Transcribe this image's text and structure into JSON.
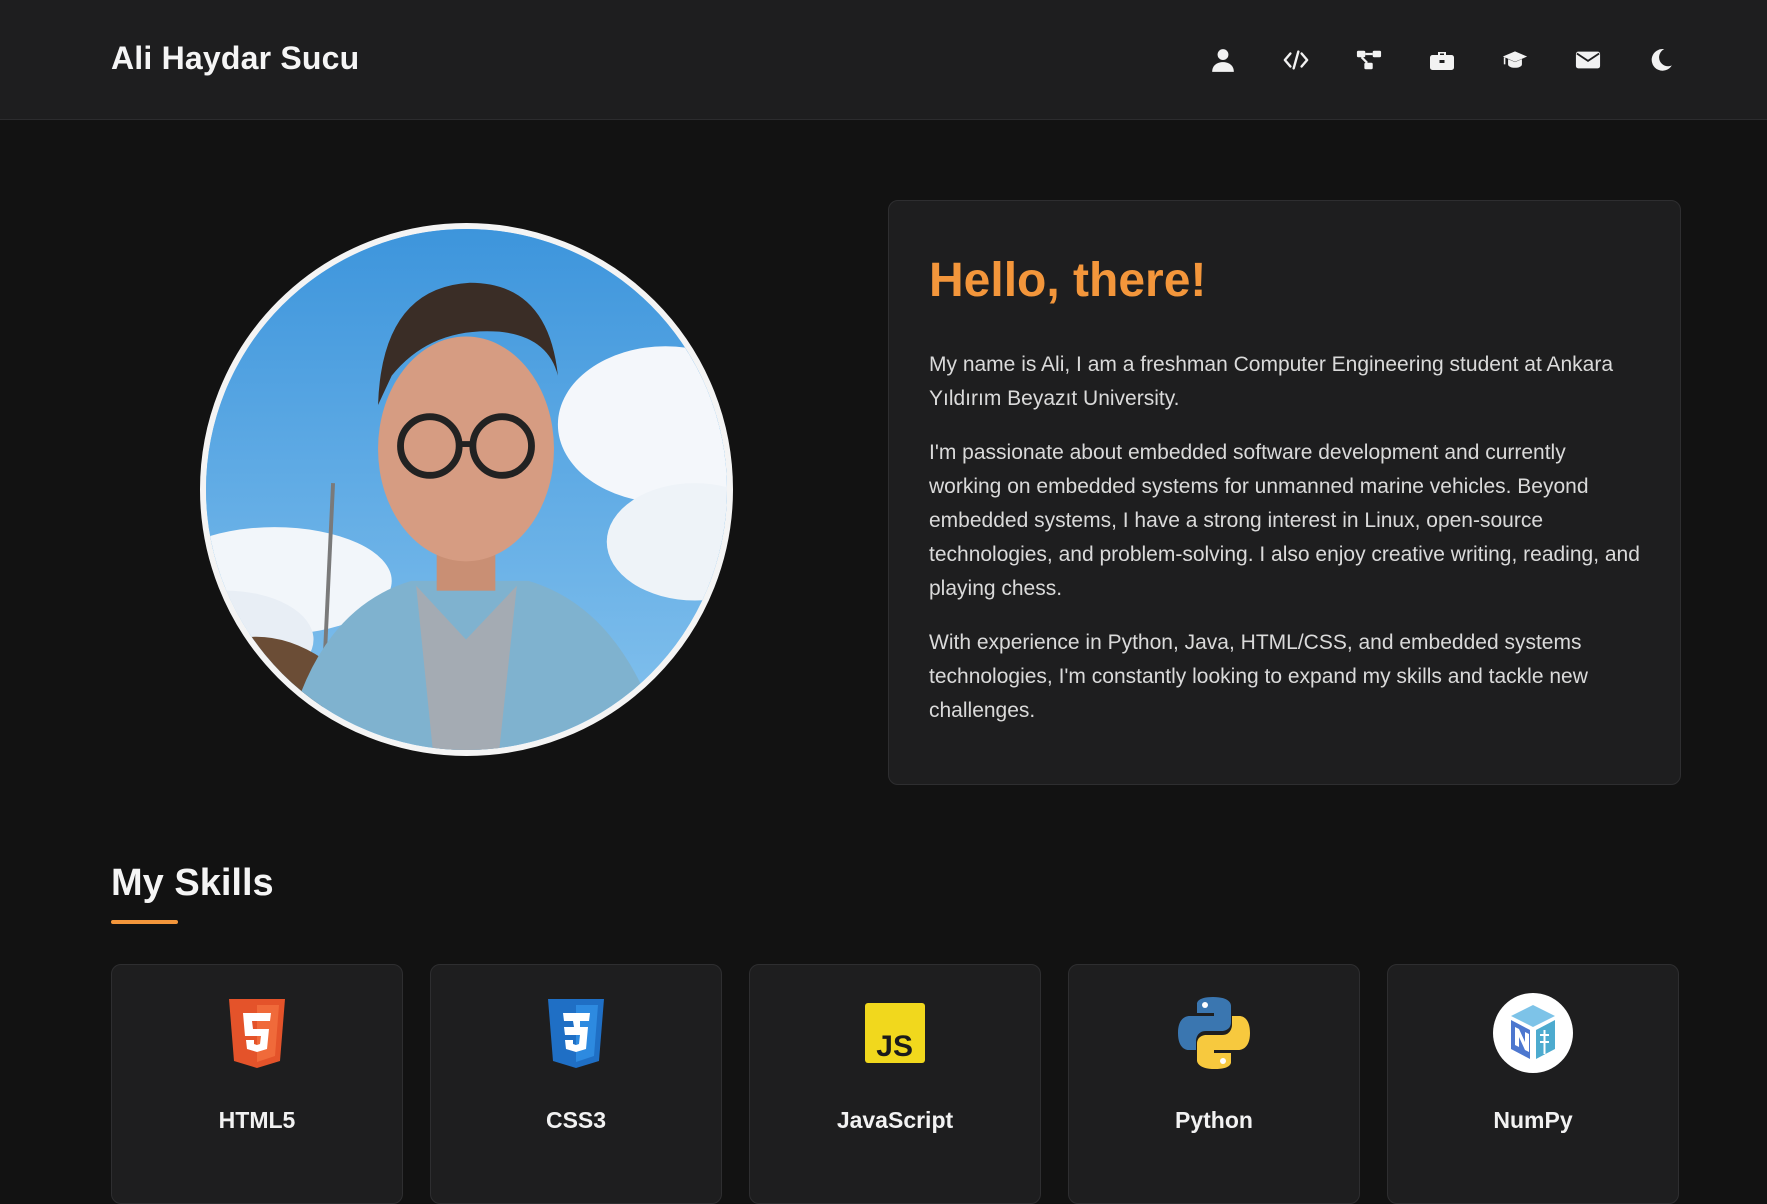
{
  "header": {
    "brand": "Ali Haydar Sucu",
    "nav_icons": [
      "user-icon",
      "code-icon",
      "project-diagram-icon",
      "briefcase-icon",
      "graduation-cap-icon",
      "envelope-icon",
      "moon-icon"
    ]
  },
  "hero": {
    "photo": "profile-photo"
  },
  "about": {
    "title": "Hello, there!",
    "paragraphs": [
      "My name is Ali, I am a freshman Computer Engineering student at Ankara Yıldırım Beyazıt University.",
      "I'm passionate about embedded software development and currently working on embedded systems for unmanned marine vehicles. Beyond embedded systems, I have a strong interest in Linux, open-source technologies, and problem-solving. I also enjoy creative writing, reading, and playing chess.",
      "With experience in Python, Java, HTML/CSS, and embedded systems technologies, I'm constantly looking to expand my skills and tackle new challenges."
    ]
  },
  "skills": {
    "title": "My Skills",
    "items": [
      {
        "name": "HTML5",
        "icon": "html5-icon"
      },
      {
        "name": "CSS3",
        "icon": "css3-icon"
      },
      {
        "name": "JavaScript",
        "icon": "javascript-icon"
      },
      {
        "name": "Python",
        "icon": "python-icon"
      },
      {
        "name": "NumPy",
        "icon": "numpy-icon"
      }
    ]
  },
  "colors": {
    "accent": "#f3963b",
    "background": "#121212",
    "card": "#1e1e1f"
  }
}
